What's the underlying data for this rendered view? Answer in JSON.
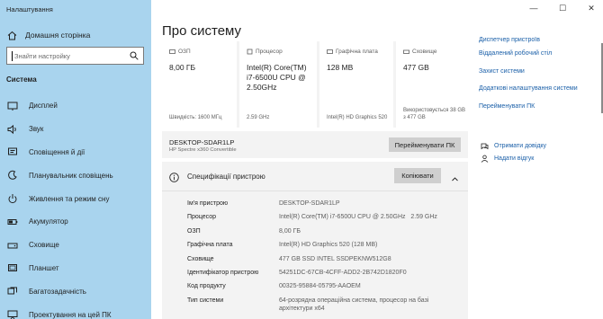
{
  "app": {
    "title": "Налаштування"
  },
  "window_controls": {
    "minimize": "—",
    "maximize": "☐",
    "close": "✕"
  },
  "sidebar": {
    "home_label": "Домашня сторінка",
    "search_placeholder": "Знайти настройку",
    "section_title": "Система",
    "items": [
      {
        "label": "Дисплей",
        "icon": "display-icon"
      },
      {
        "label": "Звук",
        "icon": "sound-icon"
      },
      {
        "label": "Сповіщення й дії",
        "icon": "notifications-icon"
      },
      {
        "label": "Планувальник сповіщень",
        "icon": "focus-assist-icon"
      },
      {
        "label": "Живлення та режим сну",
        "icon": "power-icon"
      },
      {
        "label": "Акумулятор",
        "icon": "battery-icon"
      },
      {
        "label": "Сховище",
        "icon": "storage-icon"
      },
      {
        "label": "Планшет",
        "icon": "tablet-icon"
      },
      {
        "label": "Багатозадачність",
        "icon": "multitasking-icon"
      },
      {
        "label": "Проектування на цей ПК",
        "icon": "projecting-icon"
      }
    ]
  },
  "main": {
    "title": "Про систему",
    "cards": [
      {
        "label": "ОЗП",
        "value": "8,00 ГБ",
        "sub": "Швидкість: 1600 МГц"
      },
      {
        "label": "Процесор",
        "value": "Intel(R) Core(TM) i7-6500U CPU @ 2.50GHz",
        "sub": "2.59 GHz"
      },
      {
        "label": "Графічна плата",
        "value": "128 MB",
        "sub": "Intel(R) HD Graphics 520"
      },
      {
        "label": "Сховище",
        "value": "477 GB",
        "sub": "Використовується 38 GB з 477 GB"
      }
    ],
    "device": {
      "name": "DESKTOP-SDAR1LP",
      "model": "HP Spectre x360 Convertible",
      "rename_button": "Перейменувати ПК"
    },
    "specs": {
      "title": "Специфікації пристрою",
      "copy_button": "Копіювати",
      "rows": [
        {
          "key": "Ім'я пристрою",
          "value": "DESKTOP-SDAR1LP"
        },
        {
          "key": "Процесор",
          "value": "Intel(R) Core(TM) i7-6500U CPU @ 2.50GHz   2.59 GHz"
        },
        {
          "key": "ОЗП",
          "value": "8,00 ГБ"
        },
        {
          "key": "Графічна плата",
          "value": "Intel(R) HD Graphics 520 (128 MB)"
        },
        {
          "key": "Сховище",
          "value": "477 GB SSD INTEL SSDPEKNW512G8"
        },
        {
          "key": "Ідентифікатор пристрою",
          "value": "54251DC-67CB-4CFF-ADD2-2B742D1820F0"
        },
        {
          "key": "Код продукту",
          "value": "00325-95884-05795-AAOEM"
        },
        {
          "key": "Тип системи",
          "value": "64-розрядна операційна система, процесор на базі архітектури x64"
        }
      ]
    }
  },
  "related": {
    "partial_link": "Диспетчер пристроїв",
    "links": [
      "Віддалений робочий стіл",
      "Захист системи",
      "Додаткові налаштування системи",
      "Перейменувати ПК"
    ]
  },
  "help": {
    "get_help": "Отримати довідку",
    "feedback": "Надати відгук"
  }
}
